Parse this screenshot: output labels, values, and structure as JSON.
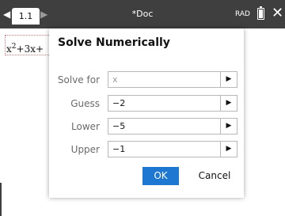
{
  "topbar": {
    "tab_prev_icon": "◀",
    "tab_label": "1.1",
    "tab_next_icon": "▶",
    "doc_title": "*Doc",
    "mode": "RAD",
    "close_icon": "✕"
  },
  "workspace": {
    "expression": {
      "x": "x",
      "exp": "2",
      "rest": "+3x+"
    }
  },
  "dialog": {
    "title": "Solve Numerically",
    "fields": [
      {
        "label": "Solve for",
        "value": "x",
        "placeholder": true
      },
      {
        "label": "Guess",
        "value": "−2"
      },
      {
        "label": "Lower",
        "value": "−5"
      },
      {
        "label": "Upper",
        "value": "−1"
      }
    ],
    "arrow_icon": "▶",
    "ok_label": "OK",
    "cancel_label": "Cancel"
  },
  "colors": {
    "topbar_bg": "#3f3f3f",
    "ok_button": "#1e78d2",
    "field_border": "#b8b8b8"
  }
}
